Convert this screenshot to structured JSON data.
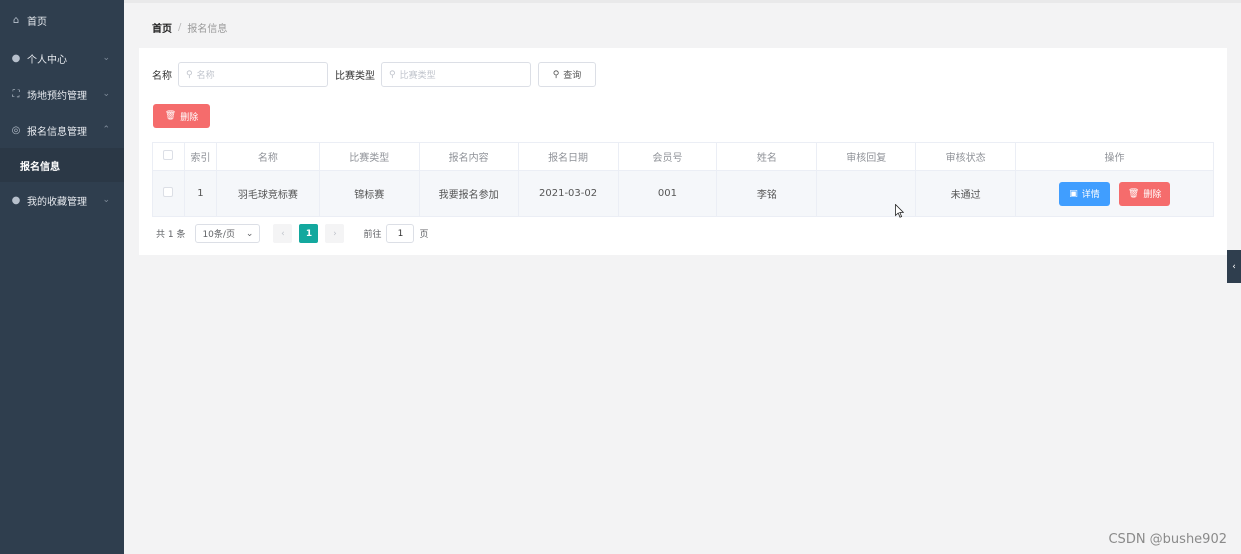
{
  "sidebar": {
    "items": [
      {
        "label": "首页",
        "icon": "home-icon"
      },
      {
        "label": "个人中心",
        "icon": "user-icon"
      },
      {
        "label": "场地预约管理",
        "icon": "expand-icon"
      },
      {
        "label": "报名信息管理",
        "icon": "compass-icon"
      },
      {
        "label": "我的收藏管理",
        "icon": "user-icon"
      }
    ],
    "subitem": "报名信息"
  },
  "breadcrumb": {
    "home": "首页",
    "separator": "/",
    "current": "报名信息"
  },
  "search": {
    "name_label": "名称",
    "name_placeholder": "名称",
    "type_label": "比赛类型",
    "type_placeholder": "比赛类型",
    "query_button": "查询"
  },
  "toolbar": {
    "delete_label": "删除"
  },
  "table": {
    "headers": [
      "索引",
      "名称",
      "比赛类型",
      "报名内容",
      "报名日期",
      "会员号",
      "姓名",
      "审核回复",
      "审核状态",
      "操作"
    ],
    "rows": [
      {
        "index": "1",
        "name": "羽毛球竞标赛",
        "type": "锦标赛",
        "content": "我要报名参加",
        "date": "2021-03-02",
        "member_no": "001",
        "person": "李铭",
        "reply": "",
        "status": "未通过",
        "detail_label": "详情",
        "delete_label": "删除"
      }
    ]
  },
  "pagination": {
    "total": "共 1 条",
    "page_size": "10条/页",
    "current_page": "1",
    "goto_prefix": "前往",
    "goto_value": "1",
    "goto_suffix": "页"
  },
  "watermark": "CSDN @bushe902",
  "colors": {
    "sidebar": "#2f3e4e",
    "danger": "#f56c6c",
    "primary": "#409eff",
    "page_active": "#13a89e"
  }
}
